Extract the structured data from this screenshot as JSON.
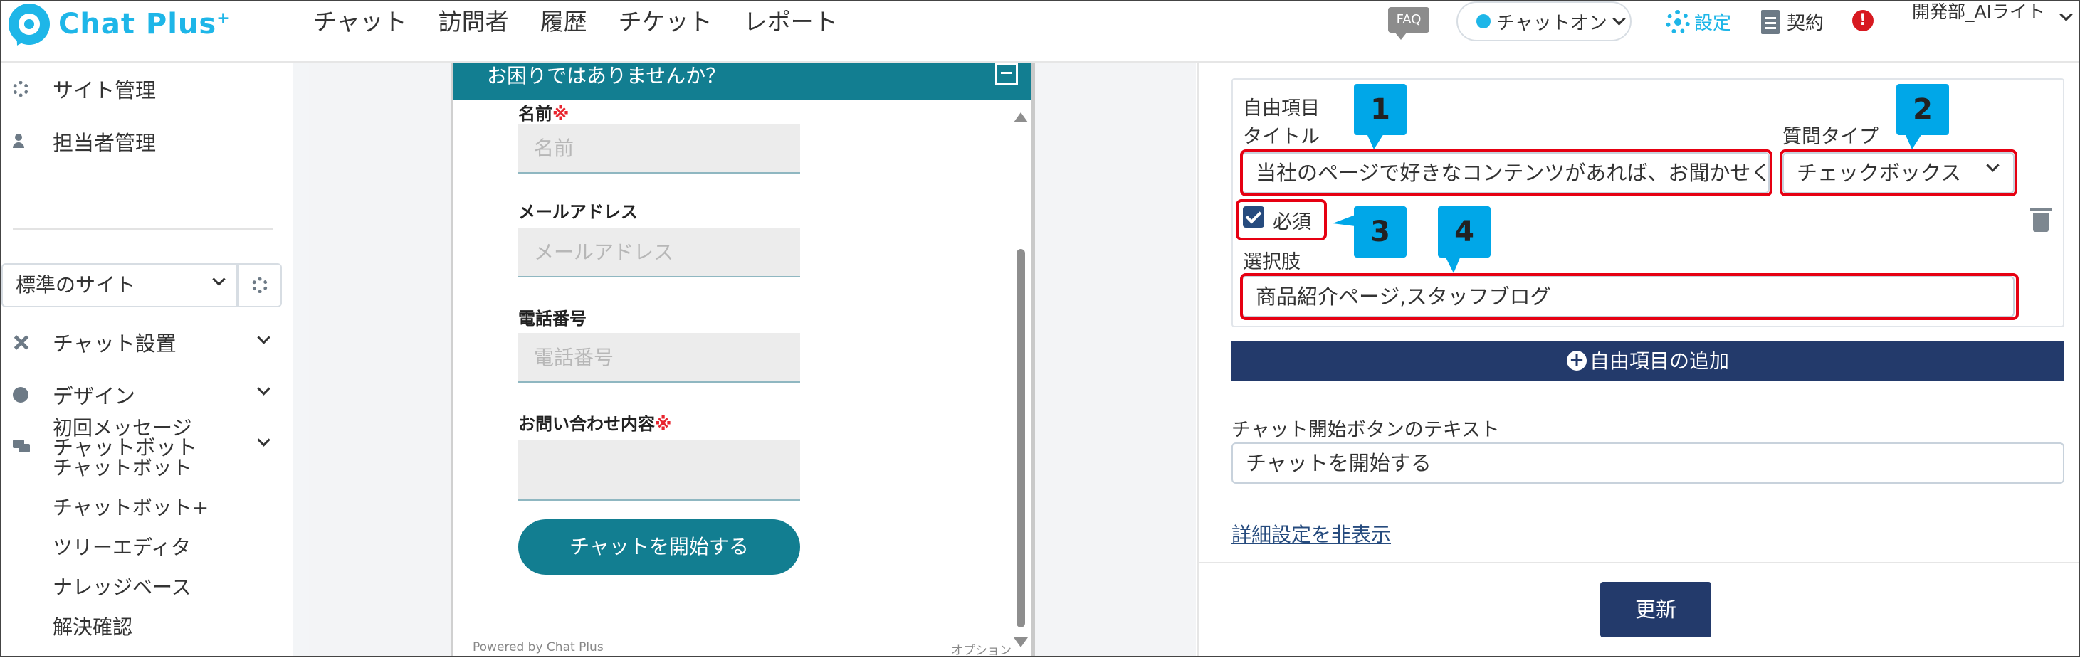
{
  "header": {
    "logo_text": "Chat Plus",
    "logo_sup": "+",
    "nav": [
      "チャット",
      "訪問者",
      "履歴",
      "チケット",
      "レポート"
    ],
    "faq_label": "FAQ",
    "status_label": "チャットオン",
    "settings_label": "設定",
    "contract_label": "契約",
    "alert_label": "!",
    "user_name": "開発部_AIライト"
  },
  "sidebar": {
    "site_admin": "サイト管理",
    "staff_admin": "担当者管理",
    "site_select": "標準のサイト",
    "chat_setup": "チャット設置",
    "design": "デザイン",
    "chatbot": "チャットボット",
    "sub_items": [
      "初回メッセージ",
      "チャットボット",
      "チャットボット+",
      "ツリーエディタ",
      "ナレッジベース",
      "解決確認"
    ]
  },
  "widget": {
    "header_title": "お困りではありませんか？",
    "name_label": "名前",
    "required_mark": "※",
    "name_placeholder": "名前",
    "email_label": "メールアドレス",
    "email_placeholder": "メールアドレス",
    "phone_label": "電話番号",
    "phone_placeholder": "電話番号",
    "inquiry_label": "お問い合わせ内容",
    "start_button": "チャットを開始する",
    "powered_by": "Powered by Chat Plus",
    "option_label": "オプション"
  },
  "form": {
    "free_item_label": "自由項目",
    "title_label": "タイトル",
    "title_value": "当社のページで好きなコンテンツがあれば、お聞かせくだ",
    "question_type_label": "質問タイプ",
    "question_type_value": "チェックボックス",
    "required_label": "必須",
    "required_checked": true,
    "choices_label": "選択肢",
    "choices_value": "商品紹介ページ,スタッフブログ",
    "add_item_button": "自由項目の追加",
    "start_button_text_label": "チャット開始ボタンのテキスト",
    "start_button_text_value": "チャットを開始する",
    "hide_advanced_link": "詳細設定を非表示",
    "update_button": "更新"
  },
  "callouts": [
    "1",
    "2",
    "3",
    "4"
  ],
  "colors": {
    "brand": "#1eb6e8",
    "widget_teal": "#127e91",
    "navy": "#233a6b",
    "callout_blue": "#00a7e8",
    "highlight_red": "#e60012"
  }
}
